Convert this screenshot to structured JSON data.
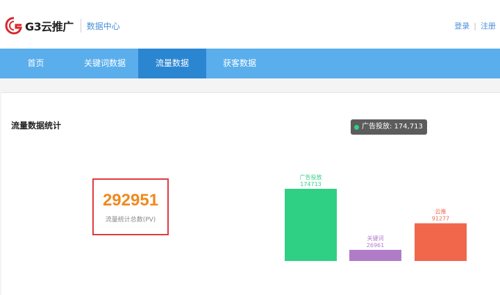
{
  "header": {
    "logo_text": "G3云推广",
    "subtitle": "数据中心",
    "login": "登录",
    "register": "注册"
  },
  "nav": {
    "items": [
      {
        "label": "首页",
        "active": false
      },
      {
        "label": "关键词数据",
        "active": false
      },
      {
        "label": "流量数据",
        "active": true
      },
      {
        "label": "获客数据",
        "active": false
      }
    ]
  },
  "section": {
    "title": "流量数据统计"
  },
  "summary": {
    "value": "292951",
    "label": "流量统计总数(PV)"
  },
  "colors": {
    "nav_bg": "#5aaeec",
    "nav_active": "#2b86d2",
    "accent_orange": "#f0891f",
    "box_border": "#e0393e"
  },
  "chart_data": {
    "type": "bar",
    "categories": [
      "广告投放",
      "关键词",
      "云推"
    ],
    "values": [
      174713,
      26961,
      91277
    ],
    "value_labels": [
      "174713",
      "26961",
      "91277"
    ],
    "colors": [
      "#2fd084",
      "#b07cc8",
      "#f0674c"
    ],
    "ylim": [
      0,
      174713
    ],
    "tooltip": {
      "text": "广告投放: 174,713"
    }
  }
}
